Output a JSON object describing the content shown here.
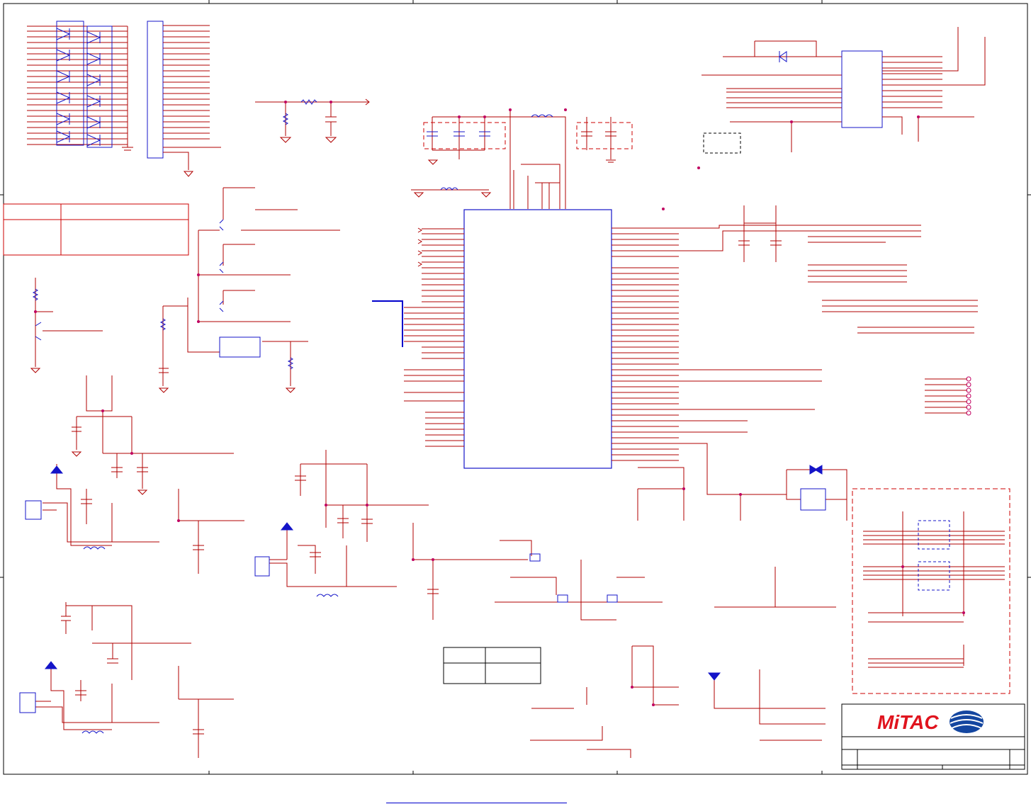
{
  "sheet": {
    "logo": {
      "text": "MiTAC",
      "brand_color": "#e0141e",
      "globe_color": "#1446a0"
    },
    "colors": {
      "frame": "#000000",
      "wire": "#b00000",
      "component": "#1414c8",
      "junction": "#c00060",
      "dashed_box": "#cc0000",
      "bus": "#0000cc"
    },
    "regions": [
      "connector-array",
      "rc-filter",
      "decoupling-caps",
      "main-ic",
      "transistor-switches",
      "power-switch-circuits",
      "relay-circuit",
      "resistor-networks",
      "title-block"
    ]
  }
}
